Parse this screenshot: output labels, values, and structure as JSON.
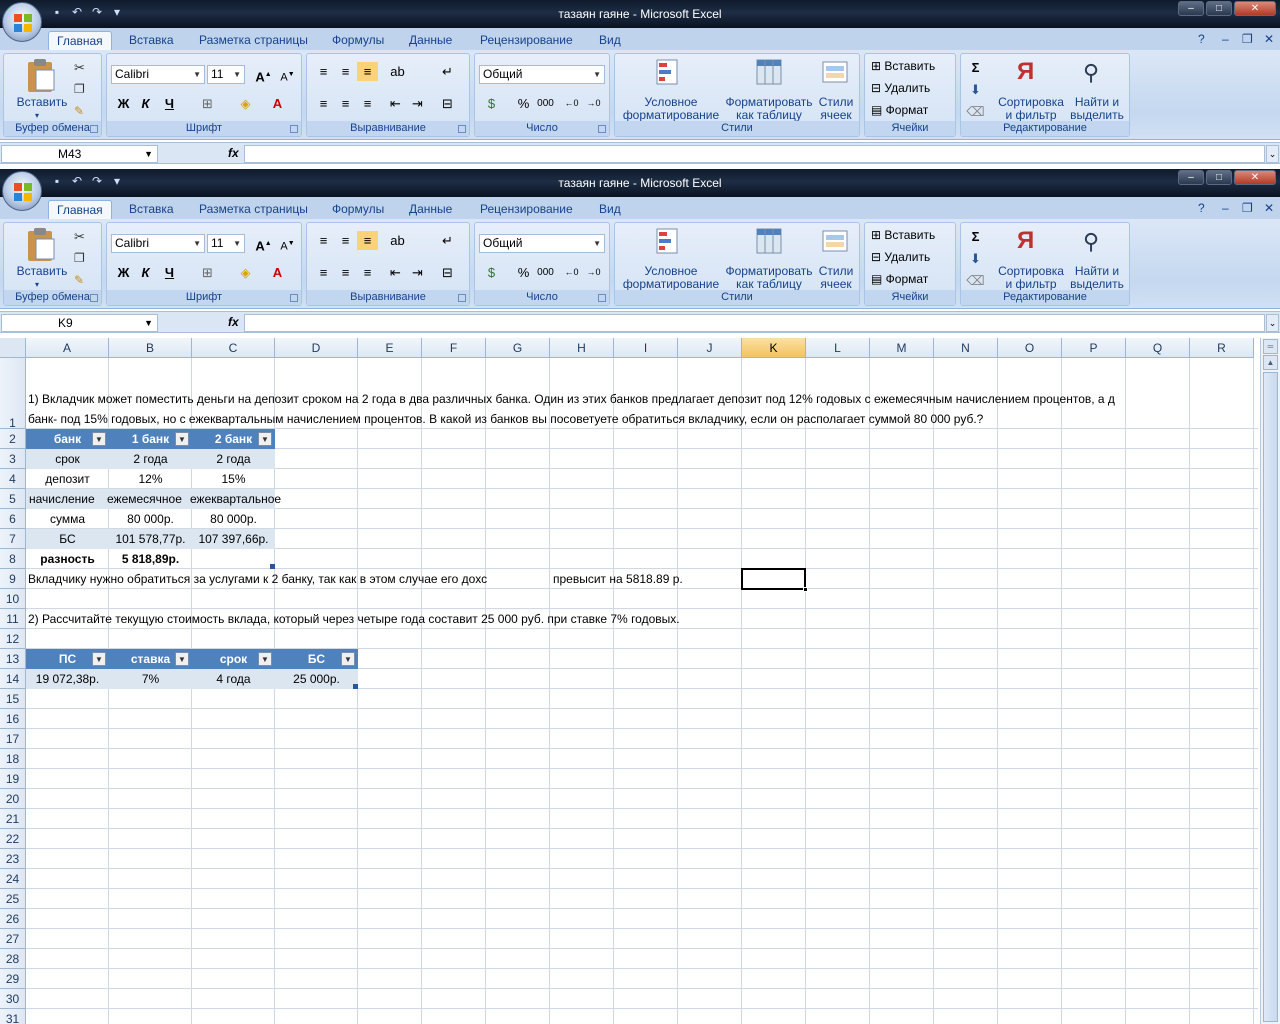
{
  "windows": [
    {
      "title": "тазаян гаяне - Microsoft Excel",
      "name_box": "M43",
      "formula": ""
    },
    {
      "title": "тазаян гаяне - Microsoft Excel",
      "name_box": "K9",
      "formula": ""
    }
  ],
  "tabs": [
    "Главная",
    "Вставка",
    "Разметка страницы",
    "Формулы",
    "Данные",
    "Рецензирование",
    "Вид"
  ],
  "ribbon": {
    "paste": "Вставить",
    "clipboard_group": "Буфер обмена",
    "font_name": "Calibri",
    "font_size": "11",
    "bold": "Ж",
    "italic": "К",
    "underline": "Ч",
    "font_group": "Шрифт",
    "align_group": "Выравнивание",
    "number_format": "Общий",
    "percent": "%",
    "thousands": "000",
    "number_group": "Число",
    "cond_format_1": "Условное",
    "cond_format_2": "форматирование",
    "format_table_1": "Форматировать",
    "format_table_2": "как таблицу",
    "cell_styles_1": "Стили",
    "cell_styles_2": "ячеек",
    "styles_group": "Стили",
    "insert": "Вставить",
    "delete": "Удалить",
    "format": "Формат",
    "cells_group": "Ячейки",
    "sort_1": "Сортировка",
    "sort_2": "и фильтр",
    "find_1": "Найти и",
    "find_2": "выделить",
    "editing_group": "Редактирование"
  },
  "columns": [
    "A",
    "B",
    "C",
    "D",
    "E",
    "F",
    "G",
    "H",
    "I",
    "J",
    "K",
    "L",
    "M",
    "N",
    "O",
    "P",
    "Q",
    "R"
  ],
  "rows": [
    "1",
    "2",
    "3",
    "4",
    "5",
    "6",
    "7",
    "8",
    "9",
    "10",
    "11",
    "12",
    "13",
    "14",
    "15",
    "16",
    "17",
    "18",
    "19",
    "20",
    "21",
    "22",
    "23",
    "24",
    "25",
    "26",
    "27",
    "28",
    "29",
    "30",
    "31"
  ],
  "sheet": {
    "task1_line1": "1) Вкладчик может поместить деньги на депозит сроком на 2 года в два различных банка. Один из этих банков предлагает депозит под 12% годовых с ежемесячным начислением процентов, а д",
    "task1_line2": "банк- под 15% годовых, но с ежеквартальным начислением процентов. В какой из банков вы посоветуете обратиться вкладчику, если он располагает суммой 80 000 руб.?",
    "table1_headers": [
      "банк",
      "1 банк",
      "2 банк"
    ],
    "table1_rows": [
      [
        "срок",
        "2 года",
        "2 года"
      ],
      [
        "депозит",
        "12%",
        "15%"
      ],
      [
        "начисление",
        "ежемесячное",
        "ежеквартальное"
      ],
      [
        "сумма",
        "80 000р.",
        "80 000р."
      ],
      [
        "БС",
        "101 578,77р.",
        "107 397,66р."
      ],
      [
        "разность",
        "5 818,89р.",
        ""
      ]
    ],
    "answer1a": "Вкладчику нужно обратиться за услугами к 2 банку,  так как в этом случае его дохс",
    "answer1b": "превысит на 5818.89 р.",
    "task2": "2) Рассчитайте текущую стоимость вклада, который через четыре года составит 25 000 руб. при ставке 7% годовых.",
    "table2_headers": [
      "ПС",
      "ставка",
      "срок",
      "БС"
    ],
    "table2_values": [
      "19 072,38р.",
      "7%",
      "4 года",
      "25 000р."
    ]
  }
}
